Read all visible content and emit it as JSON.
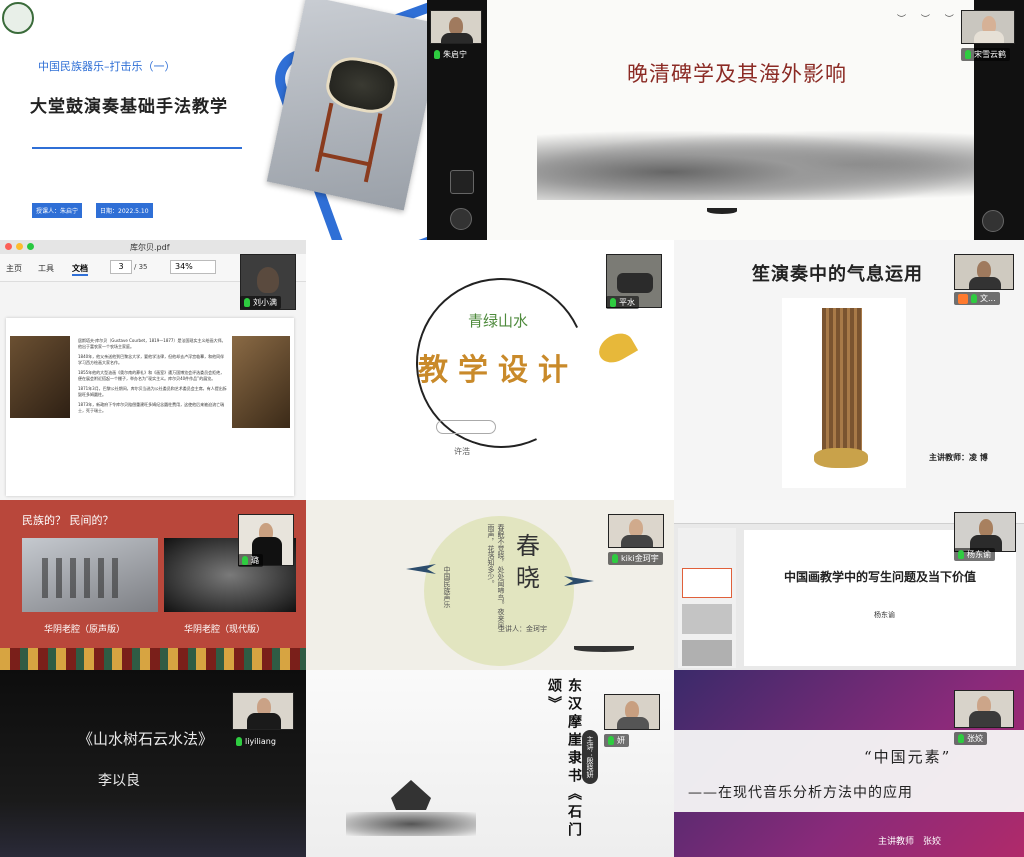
{
  "tiles": {
    "t1": {
      "subtitle": "中国民族器乐–打击乐（一）",
      "title": "大堂鼓演奏基础手法教学",
      "info_left": "授课人：朱启宁",
      "info_right": "日期：2022.5.10",
      "participant": "朱启宁"
    },
    "t2": {
      "title": "晚清碑学及其海外影响",
      "participant": "宋雪云鹤"
    },
    "t3": {
      "filename": "库尔贝.pdf",
      "menu": [
        "主页",
        "工具",
        "文档"
      ],
      "page_current": "3",
      "page_total": "/ 35",
      "zoom": "34%",
      "participant": "刘小满",
      "bullets": [
        "居斯塔夫·库尔贝（Gustave Courbet，1819—1877）是法国现实主义绘画大师。他出于富农家一个农场主家庭。",
        "1840年，他父亲送他到巴黎念大学，要他学法律，但他却去卢浮宫临摹，和他同伴学习西方绘画大家名作。",
        "1855年他的大型油画《奥尔南的葬礼》和《画室》遭万国博览会评选委员会拒绝，便在展会附近搭起一个棚子，举办名为“现实主义。库尔贝40件作品”的展览。",
        "1871年3月，巴黎公社期间，库尔贝当选为公社委员和艺术委员会主席，有人提出拆毁旺多姆圆柱。",
        "1873年，新政府下令库尔贝赔偿重建旺多姆纪念圆柱费用，这使他后来被迫流亡瑞士，死于瑞士。"
      ]
    },
    "t4": {
      "left_title": "青绿山水",
      "main_title": "教学设计",
      "author": "许浩",
      "participant": "平水"
    },
    "t5": {
      "title": "笙演奏中的气息运用",
      "teacher": "主讲教师：凌 博",
      "participant": "文..."
    },
    "t6": {
      "title": "民族的？ 民间的？",
      "caption_left": "华阴老腔（原声版）",
      "caption_right": "华阴老腔（现代版）",
      "participant": "璐"
    },
    "t7": {
      "title_char1": "春",
      "title_char2": "晓",
      "poem": "春眠不觉晓，处处闻啼鸟。夜来风雨声，花落知多少。",
      "side": "中国民族声乐",
      "speaker": "主讲人：金珂宇",
      "participant": "kiki金珂宇"
    },
    "t8": {
      "title": "中国画教学中的写生问题及当下价值",
      "author": "杨东谕",
      "participant": "杨东谕"
    },
    "t9": {
      "title": "《山水树石云水法》",
      "author": "李以良",
      "participant": "liyiliang"
    },
    "t10": {
      "title": "东汉摩崖隶书《石门颂》",
      "tag": "主讲：殷晓妍",
      "participant": "妍"
    },
    "t11": {
      "quote": "“中国元素”",
      "title": "——在现代音乐分析方法中的应用",
      "teacher": "主讲教师　张姣",
      "participant": "张姣"
    }
  },
  "colors": {
    "blue_accent": "#2f6fd6",
    "mic_green": "#2ecc40",
    "folk_red": "#b9473b",
    "gold_title": "#c98a2a",
    "green_title": "#4e8a3c"
  }
}
